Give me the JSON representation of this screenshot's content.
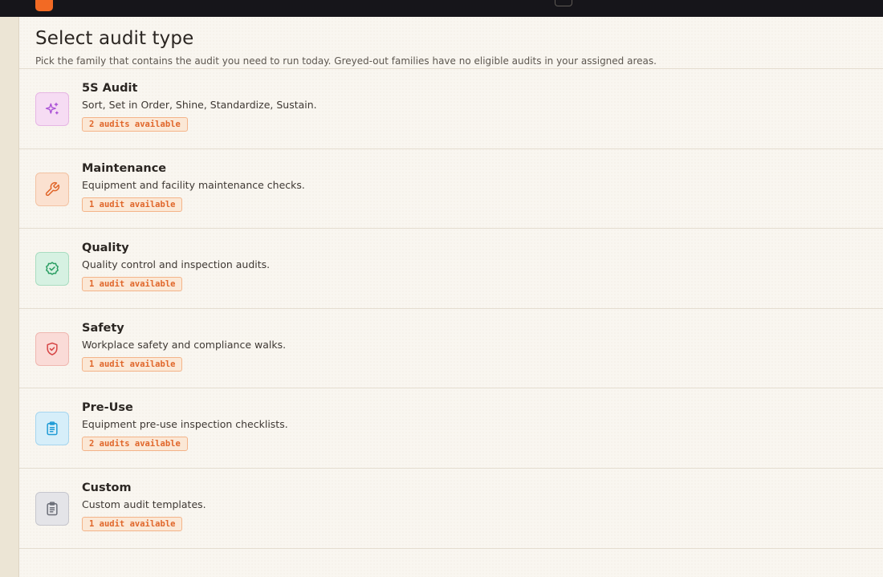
{
  "page": {
    "title": "Select audit type",
    "subtitle": "Pick the family that contains the audit you need to run today. Greyed-out families have no eligible audits in your assigned areas."
  },
  "families": [
    {
      "title": "5S Audit",
      "description": "Sort, Set in Order, Shine, Standardize, Sustain.",
      "badge": "2 audits available",
      "icon": "sparkle-icon",
      "color": "#a94fd6"
    },
    {
      "title": "Maintenance",
      "description": "Equipment and facility maintenance checks.",
      "badge": "1 audit available",
      "icon": "wrench-icon",
      "color": "#e0662a"
    },
    {
      "title": "Quality",
      "description": "Quality control and inspection audits.",
      "badge": "1 audit available",
      "icon": "badge-check-icon",
      "color": "#2a9d62"
    },
    {
      "title": "Safety",
      "description": "Workplace safety and compliance walks.",
      "badge": "1 audit available",
      "icon": "shield-check-icon",
      "color": "#d64545"
    },
    {
      "title": "Pre-Use",
      "description": "Equipment pre-use inspection checklists.",
      "badge": "2 audits available",
      "icon": "clipboard-list-icon",
      "color": "#1f9bd6"
    },
    {
      "title": "Custom",
      "description": "Custom audit templates.",
      "badge": "1 audit available",
      "icon": "clipboard-list-icon",
      "color": "#6b6e78"
    }
  ]
}
